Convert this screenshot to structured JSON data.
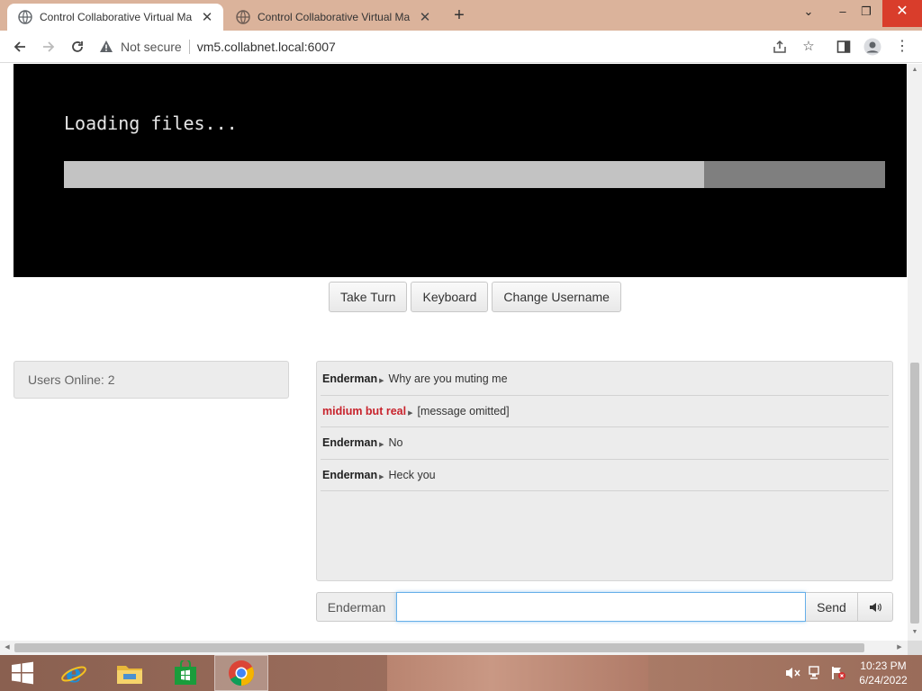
{
  "browser": {
    "tabs": [
      {
        "title": "Control Collaborative Virtual Ma",
        "active": true
      },
      {
        "title": "Control Collaborative Virtual Ma",
        "active": false
      }
    ],
    "new_tab_label": "+",
    "security_label": "Not secure",
    "url": "vm5.collabnet.local:6007",
    "window_controls": {
      "chevron": "⌄",
      "minimize": "–",
      "restore": "❐",
      "close": "✕"
    }
  },
  "vm": {
    "loading_text": "Loading files...",
    "progress_fraction": 0.78
  },
  "controls": {
    "take_turn": "Take Turn",
    "keyboard": "Keyboard",
    "change_username": "Change Username"
  },
  "users": {
    "online_label": "Users Online: 2"
  },
  "chat": {
    "messages": [
      {
        "user": "Enderman",
        "text": "Why are you muting me",
        "user_color": "#222222"
      },
      {
        "user": "midium but real",
        "text": "[message omitted]",
        "user_color": "#c8232c"
      },
      {
        "user": "Enderman",
        "text": "No",
        "user_color": "#222222"
      },
      {
        "user": "Enderman",
        "text": "Heck you",
        "user_color": "#222222"
      }
    ],
    "username": "Enderman",
    "input_value": "",
    "send_label": "Send"
  },
  "taskbar": {
    "apps": [
      "windows-start-icon",
      "internet-explorer-icon",
      "file-explorer-icon",
      "store-icon",
      "chrome-icon"
    ],
    "time": "10:23 PM",
    "date": "6/24/2022"
  }
}
